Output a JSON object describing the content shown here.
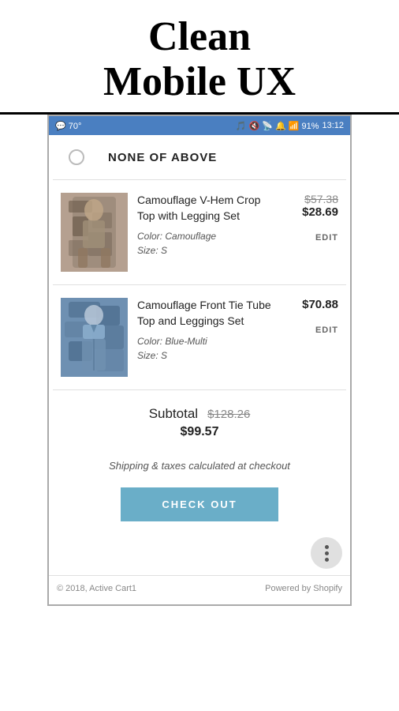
{
  "header": {
    "line1": "Clean",
    "line2": "Mobile UX"
  },
  "status_bar": {
    "left": "💬 70°",
    "icons": "🎵 🔇 📡 🔔 📶 91%",
    "time": "13:12"
  },
  "none_above": {
    "label": "NONE OF ABOVE"
  },
  "cart_items": [
    {
      "name": "Camouflage V-Hem Crop Top with Legging Set",
      "color": "Camouflage",
      "size": "S",
      "price_original": "$57.38",
      "price_sale": "$28.69",
      "edit_label": "EDIT",
      "color_label": "Color:",
      "size_label": "Size:",
      "bg": "#b0a090"
    },
    {
      "name": "Camouflage Front Tie Tube Top and Leggings Set",
      "color": "Blue-Multi",
      "size": "S",
      "price_original": null,
      "price_sale": "$70.88",
      "edit_label": "EDIT",
      "color_label": "Color:",
      "size_label": "Size:",
      "bg": "#7090b0"
    }
  ],
  "subtotal": {
    "label": "Subtotal",
    "original": "$128.26",
    "sale": "$99.57"
  },
  "shipping_note": "Shipping & taxes calculated at checkout",
  "checkout_button": "CHECK OUT",
  "footer": {
    "left": "© 2018, Active Cart1",
    "right": "Powered by Shopify"
  }
}
